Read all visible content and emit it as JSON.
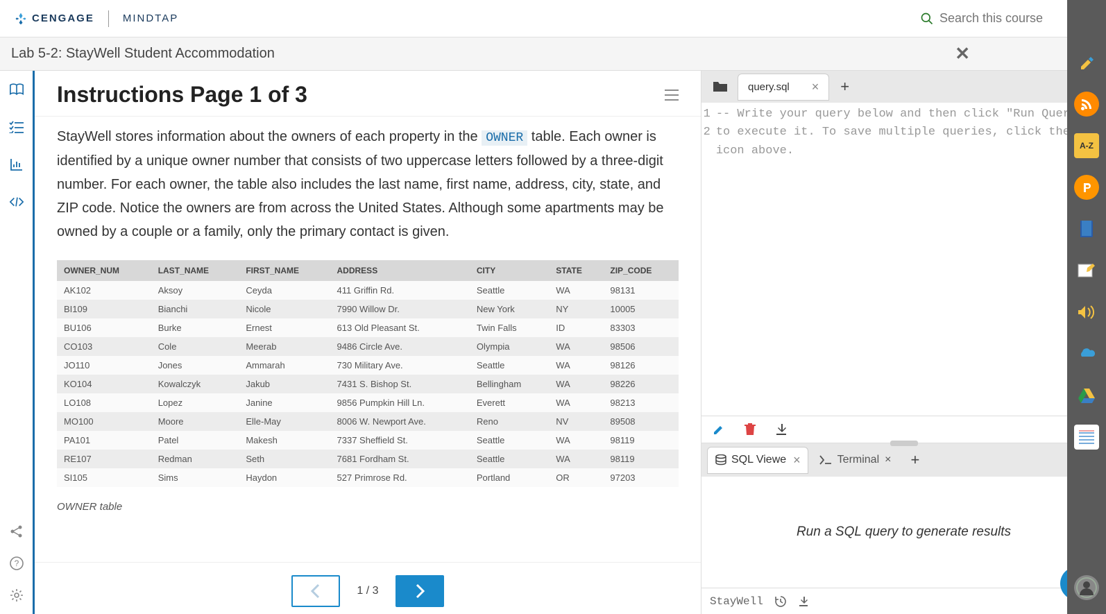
{
  "header": {
    "brand1": "CENGAGE",
    "brand2": "MINDTAP",
    "search_placeholder": "Search this course"
  },
  "subheader": {
    "title": "Lab 5-2: StayWell Student Accommodation"
  },
  "instructions": {
    "heading": "Instructions Page 1 of 3",
    "para_pre": "StayWell stores information about the owners of each property in the ",
    "code_token": "OWNER",
    "para_post": " table. Each owner is identified by a unique owner number that consists of two uppercase letters followed by a three-digit number. For each owner, the table also includes the last name, first name, address, city, state, and ZIP code. Notice the owners are from across the United States. Although some apartments may be owned by a couple or a family, only the primary contact is given.",
    "table_caption": "OWNER table",
    "columns": [
      "OWNER_NUM",
      "LAST_NAME",
      "FIRST_NAME",
      "ADDRESS",
      "CITY",
      "STATE",
      "ZIP_CODE"
    ],
    "rows": [
      [
        "AK102",
        "Aksoy",
        "Ceyda",
        "411 Griffin Rd.",
        "Seattle",
        "WA",
        "98131"
      ],
      [
        "BI109",
        "Bianchi",
        "Nicole",
        "7990 Willow Dr.",
        "New York",
        "NY",
        "10005"
      ],
      [
        "BU106",
        "Burke",
        "Ernest",
        "613 Old Pleasant St.",
        "Twin Falls",
        "ID",
        "83303"
      ],
      [
        "CO103",
        "Cole",
        "Meerab",
        "9486 Circle Ave.",
        "Olympia",
        "WA",
        "98506"
      ],
      [
        "JO110",
        "Jones",
        "Ammarah",
        "730 Military Ave.",
        "Seattle",
        "WA",
        "98126"
      ],
      [
        "KO104",
        "Kowalczyk",
        "Jakub",
        "7431 S. Bishop St.",
        "Bellingham",
        "WA",
        "98226"
      ],
      [
        "LO108",
        "Lopez",
        "Janine",
        "9856 Pumpkin Hill Ln.",
        "Everett",
        "WA",
        "98213"
      ],
      [
        "MO100",
        "Moore",
        "Elle-May",
        "8006 W. Newport Ave.",
        "Reno",
        "NV",
        "89508"
      ],
      [
        "PA101",
        "Patel",
        "Makesh",
        "7337 Sheffield St.",
        "Seattle",
        "WA",
        "98119"
      ],
      [
        "RE107",
        "Redman",
        "Seth",
        "7681 Fordham St.",
        "Seattle",
        "WA",
        "98119"
      ],
      [
        "SI105",
        "Sims",
        "Haydon",
        "527 Primrose Rd.",
        "Portland",
        "OR",
        "97203"
      ]
    ]
  },
  "pager": {
    "text": "1 / 3"
  },
  "ide": {
    "file_tab": "query.sql",
    "gutter": [
      "1",
      "2"
    ],
    "code": "-- Write your query below and then click \"Run Query\" to execute it. To save multiple queries, click the \"+\" icon above.",
    "bottom_tabs": {
      "sql_viewer": "SQL Viewe",
      "terminal": "Terminal"
    },
    "results_placeholder": "Run a SQL query to generate results",
    "footer_db": "StayWell"
  }
}
